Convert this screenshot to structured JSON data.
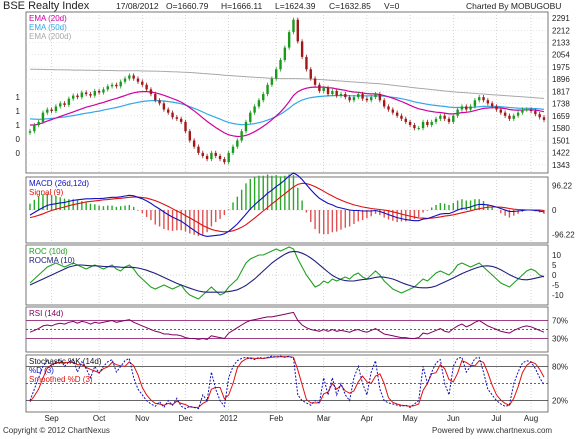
{
  "header": {
    "title": "BSE Realty Index",
    "date": "17/08/2012",
    "open": "O=1660.79",
    "high": "H=1666.11",
    "low": "L=1624.39",
    "close": "C=1632.85",
    "volume": "V=0",
    "charted_by": "Charted By MOBUGOBU"
  },
  "footer": {
    "copyright": "Copyright © 2012 ChartNexus",
    "powered": "Powered by www.chartnexus.com"
  },
  "colors": {
    "ema20": "#d000a0",
    "ema50": "#30a8e8",
    "ema200": "#a8a8a8",
    "candle_up": "#1a9a1a",
    "candle_down": "#a01818",
    "macd": "#1010c0",
    "signal": "#e01010",
    "roc": "#20a020",
    "rocma": "#202080",
    "rsi": "#800060",
    "stoch_k": "#1010c0",
    "stoch_d": "#e01010",
    "band": "#800060"
  },
  "chart_data": [
    {
      "type": "candlestick",
      "panel": "price",
      "legend": [
        "EMA (20d)",
        "EMA (50d)",
        "EMA (200d)"
      ],
      "yticks": [
        "2291",
        "2212",
        "2133",
        "2054",
        "1975",
        "1896",
        "1817",
        "1738",
        "1659",
        "1580",
        "1501",
        "1422",
        "1343"
      ],
      "left_ticks": [
        "1",
        "1",
        "1",
        "0",
        "0"
      ],
      "xticks": [
        "Sep",
        "Oct",
        "Nov",
        "Dec",
        "2012",
        "Feb",
        "Mar",
        "Apr",
        "May",
        "Jun",
        "Jul",
        "Aug"
      ],
      "ylim": [
        1290,
        2330
      ],
      "close": [
        1560,
        1600,
        1620,
        1680,
        1700,
        1690,
        1720,
        1740,
        1730,
        1770,
        1790,
        1780,
        1810,
        1800,
        1790,
        1820,
        1810,
        1830,
        1850,
        1860,
        1850,
        1880,
        1900,
        1920,
        1900,
        1880,
        1860,
        1830,
        1800,
        1760,
        1740,
        1700,
        1680,
        1650,
        1640,
        1620,
        1560,
        1500,
        1460,
        1420,
        1400,
        1380,
        1420,
        1400,
        1380,
        1360,
        1420,
        1460,
        1500,
        1560,
        1620,
        1680,
        1720,
        1760,
        1800,
        1860,
        1900,
        1960,
        2020,
        2100,
        2200,
        2280,
        2140,
        2040,
        1960,
        1900,
        1860,
        1820,
        1840,
        1800,
        1820,
        1790,
        1800,
        1780,
        1760,
        1780,
        1800,
        1770,
        1760,
        1780,
        1800,
        1760,
        1720,
        1700,
        1680,
        1660,
        1640,
        1620,
        1600,
        1580,
        1580,
        1620,
        1600,
        1620,
        1640,
        1660,
        1640,
        1620,
        1660,
        1700,
        1720,
        1700,
        1720,
        1760,
        1780,
        1760,
        1740,
        1720,
        1700,
        1680,
        1660,
        1640,
        1660,
        1680,
        1700,
        1700,
        1690,
        1670,
        1650,
        1633
      ],
      "ema20": [
        1600,
        1600,
        1605,
        1615,
        1625,
        1635,
        1645,
        1655,
        1665,
        1675,
        1685,
        1695,
        1705,
        1715,
        1722,
        1730,
        1738,
        1746,
        1755,
        1764,
        1772,
        1781,
        1790,
        1800,
        1808,
        1813,
        1816,
        1816,
        1813,
        1808,
        1801,
        1792,
        1782,
        1771,
        1760,
        1748,
        1731,
        1712,
        1692,
        1669,
        1646,
        1623,
        1603,
        1584,
        1566,
        1549,
        1537,
        1530,
        1526,
        1527,
        1533,
        1543,
        1557,
        1573,
        1591,
        1612,
        1634,
        1658,
        1685,
        1715,
        1752,
        1791,
        1815,
        1829,
        1838,
        1843,
        1845,
        1845,
        1845,
        1841,
        1839,
        1833,
        1829,
        1824,
        1817,
        1813,
        1811,
        1807,
        1803,
        1801,
        1801,
        1797,
        1790,
        1782,
        1773,
        1763,
        1752,
        1740,
        1727,
        1715,
        1705,
        1699,
        1692,
        1687,
        1683,
        1681,
        1677,
        1672,
        1672,
        1675,
        1680,
        1682,
        1686,
        1693,
        1701,
        1707,
        1710,
        1712,
        1712,
        1710,
        1706,
        1700,
        1697,
        1696,
        1697,
        1698,
        1698,
        1696,
        1692,
        1686
      ],
      "ema50": [
        1640,
        1638,
        1637,
        1638,
        1640,
        1642,
        1645,
        1649,
        1652,
        1657,
        1661,
        1666,
        1671,
        1676,
        1680,
        1686,
        1690,
        1696,
        1702,
        1708,
        1713,
        1720,
        1727,
        1735,
        1741,
        1747,
        1752,
        1755,
        1757,
        1758,
        1757,
        1755,
        1752,
        1748,
        1743,
        1737,
        1729,
        1718,
        1708,
        1696,
        1684,
        1671,
        1660,
        1649,
        1638,
        1626,
        1617,
        1610,
        1605,
        1602,
        1602,
        1605,
        1609,
        1615,
        1622,
        1632,
        1643,
        1656,
        1670,
        1688,
        1708,
        1731,
        1748,
        1761,
        1770,
        1777,
        1781,
        1784,
        1787,
        1788,
        1790,
        1790,
        1791,
        1790,
        1789,
        1789,
        1789,
        1789,
        1788,
        1788,
        1789,
        1788,
        1786,
        1783,
        1779,
        1775,
        1770,
        1764,
        1757,
        1750,
        1744,
        1739,
        1734,
        1729,
        1726,
        1723,
        1720,
        1716,
        1714,
        1713,
        1714,
        1713,
        1713,
        1715,
        1718,
        1720,
        1721,
        1721,
        1720,
        1718,
        1716,
        1713,
        1711,
        1709,
        1708,
        1708,
        1707,
        1706,
        1704,
        1701
      ],
      "ema200": [
        1960,
        1960,
        1959,
        1959,
        1958,
        1958,
        1957,
        1957,
        1956,
        1956,
        1955,
        1955,
        1955,
        1954,
        1954,
        1953,
        1953,
        1953,
        1952,
        1952,
        1951,
        1951,
        1951,
        1951,
        1950,
        1950,
        1949,
        1949,
        1948,
        1948,
        1947,
        1946,
        1945,
        1944,
        1943,
        1942,
        1941,
        1939,
        1937,
        1935,
        1933,
        1931,
        1929,
        1927,
        1925,
        1922,
        1920,
        1918,
        1916,
        1914,
        1912,
        1910,
        1908,
        1907,
        1905,
        1903,
        1902,
        1901,
        1900,
        1900,
        1900,
        1900,
        1900,
        1899,
        1898,
        1897,
        1896,
        1894,
        1892,
        1890,
        1888,
        1886,
        1884,
        1882,
        1880,
        1878,
        1876,
        1874,
        1872,
        1870,
        1868,
        1866,
        1863,
        1860,
        1857,
        1854,
        1851,
        1848,
        1844,
        1841,
        1838,
        1835,
        1832,
        1829,
        1826,
        1823,
        1820,
        1817,
        1814,
        1812,
        1810,
        1808,
        1806,
        1804,
        1802,
        1800,
        1798,
        1796,
        1794,
        1792,
        1790,
        1788,
        1786,
        1784,
        1782,
        1780,
        1778,
        1776,
        1774,
        1772
      ]
    },
    {
      "type": "line",
      "panel": "macd",
      "legend": [
        "MACD (26d,12d)",
        "Signal (9)"
      ],
      "yticks": [
        "96.22",
        "0",
        "-96.22"
      ],
      "ylim": [
        -130,
        130
      ],
      "macd": [
        -20,
        -10,
        0,
        10,
        18,
        22,
        25,
        28,
        30,
        34,
        38,
        40,
        42,
        44,
        44,
        45,
        45,
        46,
        48,
        50,
        50,
        52,
        55,
        58,
        56,
        50,
        44,
        36,
        26,
        14,
        4,
        -8,
        -18,
        -28,
        -36,
        -44,
        -56,
        -68,
        -80,
        -92,
        -100,
        -104,
        -102,
        -100,
        -98,
        -94,
        -84,
        -70,
        -55,
        -36,
        -16,
        4,
        20,
        36,
        50,
        66,
        78,
        92,
        104,
        118,
        134,
        146,
        136,
        120,
        100,
        80,
        62,
        46,
        36,
        26,
        20,
        12,
        8,
        4,
        0,
        -2,
        -2,
        -4,
        -4,
        -4,
        -2,
        -6,
        -12,
        -18,
        -24,
        -30,
        -34,
        -38,
        -40,
        -42,
        -42,
        -36,
        -34,
        -28,
        -22,
        -16,
        -14,
        -14,
        -8,
        0,
        6,
        8,
        12,
        18,
        22,
        22,
        20,
        16,
        12,
        6,
        0,
        -6,
        -6,
        -4,
        -2,
        0,
        0,
        -2,
        -4,
        -8
      ],
      "signal": [
        -30,
        -26,
        -21,
        -15,
        -8,
        -2,
        3,
        8,
        12,
        17,
        21,
        25,
        28,
        32,
        34,
        36,
        38,
        40,
        41,
        43,
        45,
        46,
        48,
        50,
        51,
        51,
        49,
        47,
        42,
        37,
        30,
        22,
        14,
        5,
        -4,
        -12,
        -22,
        -31,
        -41,
        -51,
        -61,
        -69,
        -76,
        -81,
        -84,
        -86,
        -85,
        -82,
        -76,
        -68,
        -58,
        -45,
        -32,
        -18,
        -4,
        10,
        24,
        37,
        51,
        64,
        78,
        91,
        101,
        105,
        104,
        99,
        92,
        83,
        74,
        64,
        55,
        46,
        39,
        32,
        26,
        20,
        16,
        12,
        9,
        6,
        4,
        2,
        0,
        -3,
        -7,
        -11,
        -16,
        -20,
        -24,
        -28,
        -31,
        -32,
        -33,
        -32,
        -30,
        -27,
        -24,
        -22,
        -19,
        -15,
        -11,
        -7,
        -3,
        1,
        5,
        8,
        11,
        12,
        12,
        11,
        9,
        6,
        3,
        2,
        1,
        0,
        0,
        0,
        0,
        -2
      ]
    },
    {
      "type": "line",
      "panel": "roc",
      "legend": [
        "ROC (10d)",
        "ROCMA (10)"
      ],
      "yticks": [
        "10",
        "5",
        "0",
        "-5",
        "-10"
      ],
      "ylim": [
        -15,
        15
      ],
      "roc": [
        -4,
        -2,
        0,
        2,
        4,
        5,
        6,
        5,
        4,
        5,
        6,
        5,
        4,
        3,
        4,
        5,
        4,
        3,
        4,
        5,
        3,
        2,
        4,
        5,
        3,
        0,
        -2,
        -4,
        -6,
        -7,
        -6,
        -5,
        -6,
        -7,
        -6,
        -5,
        -8,
        -10,
        -11,
        -12,
        -10,
        -8,
        -6,
        -8,
        -10,
        -9,
        -6,
        -4,
        -2,
        2,
        6,
        8,
        9,
        10,
        10,
        11,
        12,
        13,
        12,
        13,
        14,
        13,
        8,
        4,
        0,
        -3,
        -6,
        -5,
        -3,
        -4,
        -2,
        -3,
        -2,
        -1,
        -2,
        0,
        1,
        -1,
        -2,
        0,
        2,
        0,
        -3,
        -5,
        -7,
        -8,
        -9,
        -8,
        -7,
        -6,
        -4,
        -2,
        -3,
        -1,
        1,
        2,
        1,
        0,
        2,
        5,
        6,
        5,
        4,
        5,
        6,
        4,
        2,
        0,
        -2,
        -4,
        -5,
        -6,
        -4,
        -2,
        0,
        2,
        3,
        2,
        0,
        -1
      ],
      "rocma": [
        -5,
        -4,
        -3,
        -2,
        -1,
        0,
        1,
        2,
        3,
        4,
        4.5,
        5,
        5,
        4.8,
        4.6,
        4.6,
        4.5,
        4.3,
        4.2,
        4.1,
        4.1,
        3.9,
        3.8,
        3.9,
        3.8,
        3.5,
        3,
        2.4,
        1.6,
        0.8,
        -0.2,
        -1.2,
        -2.2,
        -3.2,
        -4.2,
        -5,
        -5.8,
        -6.6,
        -7.3,
        -8,
        -8.4,
        -8.6,
        -8.6,
        -8.6,
        -8.6,
        -8.5,
        -8.3,
        -7.9,
        -7.4,
        -6.4,
        -5.2,
        -3.6,
        -2,
        0,
        2,
        4,
        6,
        7.6,
        9,
        10.4,
        11.4,
        11.8,
        11.6,
        10.9,
        9.9,
        8.5,
        6.9,
        5.1,
        3.3,
        1.5,
        -0.2,
        -1.4,
        -2.3,
        -2.8,
        -3.0,
        -3.0,
        -2.6,
        -2.3,
        -2.1,
        -1.7,
        -1.2,
        -0.9,
        -1.1,
        -1.5,
        -2.0,
        -2.8,
        -3.8,
        -4.6,
        -5.3,
        -5.9,
        -6.3,
        -6.4,
        -6.4,
        -6.1,
        -5.5,
        -4.5,
        -3.5,
        -2.5,
        -1.5,
        -0.4,
        0.7,
        1.6,
        2.5,
        3.3,
        4,
        4.5,
        4.6,
        4.3,
        3.6,
        2.6,
        1.4,
        0.2,
        -0.9,
        -1.8,
        -2.3,
        -2.4,
        -2.1,
        -1.6,
        -1.1,
        -0.6
      ]
    },
    {
      "type": "line",
      "panel": "rsi",
      "legend": [
        "RSI (14d)"
      ],
      "yticks": [
        "70%",
        "30%"
      ],
      "ylim": [
        0,
        100
      ],
      "bands": [
        70,
        50,
        30
      ],
      "rsi": [
        44,
        48,
        52,
        58,
        60,
        58,
        62,
        64,
        62,
        66,
        68,
        64,
        68,
        66,
        62,
        66,
        64,
        66,
        68,
        70,
        66,
        68,
        70,
        72,
        66,
        62,
        58,
        54,
        50,
        46,
        44,
        40,
        40,
        38,
        38,
        36,
        32,
        30,
        30,
        28,
        30,
        28,
        36,
        34,
        32,
        30,
        42,
        48,
        54,
        60,
        66,
        70,
        72,
        74,
        76,
        78,
        78,
        80,
        82,
        84,
        86,
        88,
        70,
        60,
        54,
        50,
        48,
        46,
        50,
        46,
        50,
        46,
        48,
        46,
        44,
        48,
        50,
        46,
        44,
        48,
        52,
        46,
        40,
        38,
        36,
        34,
        32,
        32,
        30,
        30,
        32,
        42,
        40,
        44,
        48,
        52,
        46,
        44,
        52,
        58,
        62,
        56,
        60,
        66,
        70,
        64,
        58,
        54,
        50,
        46,
        44,
        42,
        48,
        52,
        56,
        58,
        56,
        52,
        48,
        44
      ]
    },
    {
      "type": "line",
      "panel": "stochastic",
      "legend": [
        "Stochastic %K (14d)",
        "%D (3)",
        "Smoothed %D (3)"
      ],
      "yticks": [
        "80%",
        "20%"
      ],
      "ylim": [
        0,
        100
      ],
      "bands": [
        80,
        50,
        20
      ],
      "k": [
        20,
        40,
        60,
        80,
        90,
        80,
        88,
        92,
        80,
        88,
        92,
        70,
        88,
        76,
        60,
        80,
        68,
        80,
        88,
        92,
        70,
        80,
        90,
        94,
        60,
        40,
        30,
        20,
        14,
        10,
        18,
        8,
        20,
        12,
        24,
        10,
        6,
        10,
        8,
        6,
        30,
        20,
        70,
        40,
        20,
        10,
        60,
        80,
        90,
        94,
        96,
        94,
        92,
        96,
        94,
        96,
        98,
        96,
        98,
        96,
        98,
        94,
        30,
        20,
        16,
        12,
        20,
        16,
        60,
        30,
        60,
        30,
        50,
        30,
        20,
        60,
        80,
        50,
        30,
        70,
        90,
        40,
        20,
        16,
        14,
        12,
        10,
        12,
        8,
        14,
        20,
        80,
        50,
        70,
        86,
        92,
        50,
        30,
        80,
        94,
        96,
        70,
        80,
        94,
        96,
        70,
        40,
        30,
        20,
        14,
        10,
        12,
        50,
        70,
        86,
        90,
        88,
        76,
        60,
        48
      ],
      "d": [
        18,
        28,
        40,
        60,
        77,
        83,
        86,
        87,
        87,
        87,
        87,
        83,
        83,
        78,
        75,
        72,
        69,
        76,
        79,
        87,
        83,
        81,
        80,
        88,
        81,
        65,
        43,
        30,
        21,
        15,
        14,
        12,
        15,
        13,
        19,
        15,
        13,
        9,
        8,
        8,
        15,
        19,
        40,
        43,
        43,
        23,
        30,
        50,
        77,
        88,
        93,
        95,
        94,
        94,
        94,
        95,
        96,
        97,
        97,
        97,
        97,
        96,
        74,
        48,
        22,
        16,
        16,
        16,
        32,
        35,
        50,
        40,
        47,
        37,
        33,
        37,
        53,
        63,
        53,
        50,
        63,
        67,
        50,
        25,
        17,
        14,
        12,
        11,
        10,
        11,
        14,
        38,
        50,
        67,
        69,
        83,
        76,
        57,
        53,
        68,
        90,
        87,
        82,
        81,
        90,
        87,
        69,
        47,
        30,
        21,
        15,
        12,
        24,
        44,
        69,
        82,
        88,
        85,
        75,
        61
      ]
    }
  ]
}
